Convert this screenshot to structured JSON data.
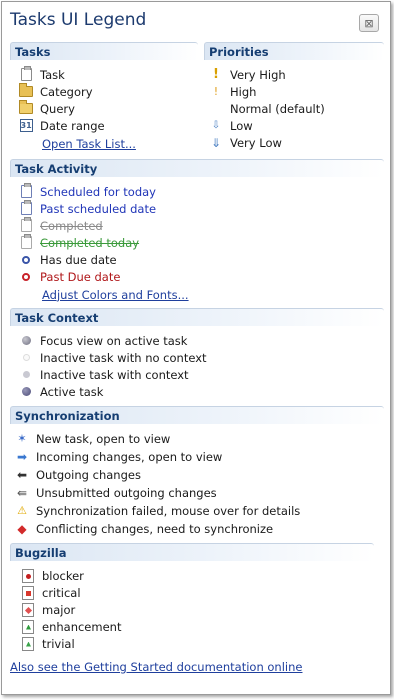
{
  "window": {
    "title": "Tasks UI Legend",
    "close_glyph": "⊠"
  },
  "tasks": {
    "heading": "Tasks",
    "items": [
      {
        "icon": "task-icon",
        "label": "Task"
      },
      {
        "icon": "category-icon",
        "label": "Category"
      },
      {
        "icon": "query-icon",
        "label": "Query"
      },
      {
        "icon": "date-range-icon",
        "label": "Date range"
      }
    ],
    "link": "Open Task List..."
  },
  "priorities": {
    "heading": "Priorities",
    "items": [
      {
        "icon": "very-high-priority-icon",
        "label": "Very High"
      },
      {
        "icon": "high-priority-icon",
        "label": "High"
      },
      {
        "icon": "",
        "label": "Normal (default)"
      },
      {
        "icon": "low-priority-icon",
        "label": "Low"
      },
      {
        "icon": "very-low-priority-icon",
        "label": "Very Low"
      }
    ]
  },
  "task_activity": {
    "heading": "Task Activity",
    "items": [
      {
        "icon": "task-icon",
        "label": "Scheduled for today"
      },
      {
        "icon": "task-icon",
        "label": "Past scheduled date"
      },
      {
        "icon": "task-icon",
        "label": "Completed"
      },
      {
        "icon": "task-icon",
        "label": "Completed today"
      },
      {
        "icon": "due-date-icon",
        "label": "Has due date"
      },
      {
        "icon": "overdue-icon",
        "label": "Past Due date"
      }
    ],
    "link": "Adjust Colors and Fonts..."
  },
  "task_context": {
    "heading": "Task Context",
    "items": [
      {
        "icon": "focus-view-icon",
        "label": "Focus view on active task"
      },
      {
        "icon": "inactive-no-context-icon",
        "label": "Inactive task with no context"
      },
      {
        "icon": "inactive-context-icon",
        "label": "Inactive task with context"
      },
      {
        "icon": "active-task-icon",
        "label": "Active task"
      }
    ]
  },
  "synchronization": {
    "heading": "Synchronization",
    "items": [
      {
        "icon": "new-task-icon",
        "label": "New task, open to view"
      },
      {
        "icon": "incoming-icon",
        "label": "Incoming changes, open to view"
      },
      {
        "icon": "outgoing-icon",
        "label": "Outgoing changes"
      },
      {
        "icon": "unsubmitted-icon",
        "label": "Unsubmitted outgoing changes"
      },
      {
        "icon": "warning-icon",
        "label": "Synchronization failed, mouse over for details"
      },
      {
        "icon": "conflict-icon",
        "label": "Conflicting changes, need to synchronize"
      }
    ]
  },
  "bugzilla": {
    "heading": "Bugzilla",
    "items": [
      {
        "icon": "blocker-icon",
        "label": "blocker"
      },
      {
        "icon": "critical-icon",
        "label": "critical"
      },
      {
        "icon": "major-icon",
        "label": "major"
      },
      {
        "icon": "enhancement-icon",
        "label": "enhancement"
      },
      {
        "icon": "trivial-icon",
        "label": "trivial"
      }
    ]
  },
  "footer_link": "Also see the Getting Started documentation online",
  "colors": {
    "section_header_text": "#163e72",
    "link": "#1f3f9d",
    "scheduled": "#2136b8",
    "past_due": "#b0171a",
    "completed_today": "#3a9a3a"
  }
}
